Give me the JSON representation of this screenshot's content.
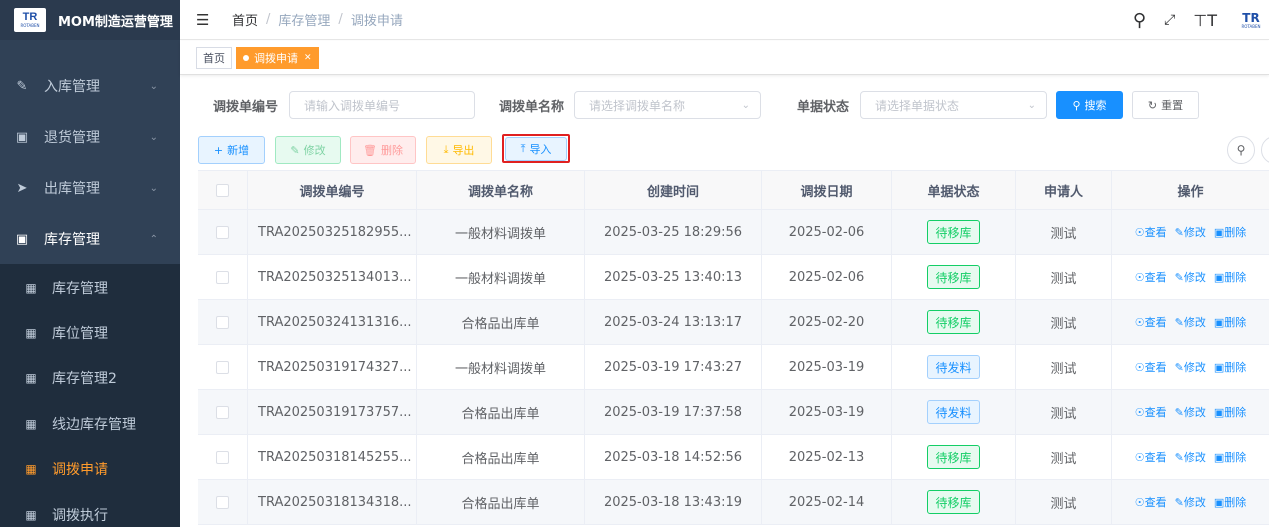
{
  "app": {
    "title": "MOM制造运营管理",
    "logo_text": "TR",
    "logo_sub": "ROTABEN"
  },
  "sidebar": {
    "menus": [
      {
        "label": "入库管理",
        "icon": "edit-icon"
      },
      {
        "label": "退货管理",
        "icon": "return-icon"
      },
      {
        "label": "出库管理",
        "icon": "send-icon"
      },
      {
        "label": "库存管理",
        "icon": "monitor-icon"
      }
    ],
    "submenu": [
      {
        "label": "库存管理"
      },
      {
        "label": "库位管理"
      },
      {
        "label": "库存管理2"
      },
      {
        "label": "线边库存管理"
      },
      {
        "label": "调拨申请",
        "active": true
      },
      {
        "label": "调拨执行"
      }
    ]
  },
  "header": {
    "breadcrumb": [
      "首页",
      "库存管理",
      "调拨申请"
    ]
  },
  "tags": {
    "home": "首页",
    "active": "调拨申请"
  },
  "search": {
    "code_label": "调拨单编号",
    "code_placeholder": "请输入调拨单编号",
    "name_label": "调拨单名称",
    "name_placeholder": "请选择调拨单名称",
    "status_label": "单据状态",
    "status_placeholder": "请选择单据状态",
    "search_btn": "搜索",
    "reset_btn": "重置"
  },
  "toolbar": {
    "add": "新增",
    "edit": "修改",
    "delete": "删除",
    "export": "导出",
    "import": "导入"
  },
  "table": {
    "headers": [
      "调拨单编号",
      "调拨单名称",
      "创建时间",
      "调拨日期",
      "单据状态",
      "申请人",
      "操作"
    ],
    "actions": {
      "view": "查看",
      "edit": "修改",
      "delete": "删除"
    },
    "rows": [
      {
        "code": "TRA20250325182955...",
        "name": "一般材料调拨单",
        "created": "2025-03-25 18:29:56",
        "date": "2025-02-06",
        "status": "待移库",
        "status_type": "move",
        "user": "测试"
      },
      {
        "code": "TRA20250325134013...",
        "name": "一般材料调拨单",
        "created": "2025-03-25 13:40:13",
        "date": "2025-02-06",
        "status": "待移库",
        "status_type": "move",
        "user": "测试"
      },
      {
        "code": "TRA20250324131316...",
        "name": "合格品出库单",
        "created": "2025-03-24 13:13:17",
        "date": "2025-02-20",
        "status": "待移库",
        "status_type": "move",
        "user": "测试"
      },
      {
        "code": "TRA20250319174327...",
        "name": "一般材料调拨单",
        "created": "2025-03-19 17:43:27",
        "date": "2025-03-19",
        "status": "待发料",
        "status_type": "issue",
        "user": "测试"
      },
      {
        "code": "TRA20250319173757...",
        "name": "合格品出库单",
        "created": "2025-03-19 17:37:58",
        "date": "2025-03-19",
        "status": "待发料",
        "status_type": "issue",
        "user": "测试"
      },
      {
        "code": "TRA20250318145255...",
        "name": "合格品出库单",
        "created": "2025-03-18 14:52:56",
        "date": "2025-02-13",
        "status": "待移库",
        "status_type": "move",
        "user": "测试"
      },
      {
        "code": "TRA20250318134318...",
        "name": "合格品出库单",
        "created": "2025-03-18 13:43:19",
        "date": "2025-02-14",
        "status": "待移库",
        "status_type": "move",
        "user": "测试"
      }
    ]
  }
}
